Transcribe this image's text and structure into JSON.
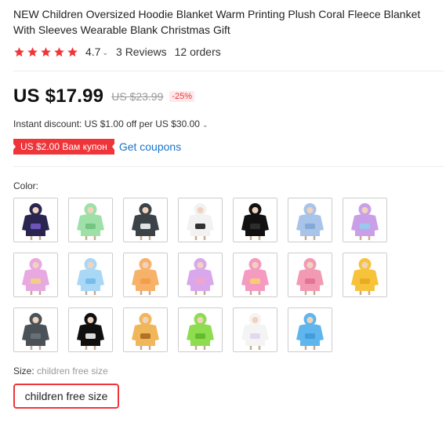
{
  "product": {
    "title": "NEW Children Oversized Hoodie Blanket Warm Printing Plush Coral Fleece Blanket With Sleeves Wearable Blank Christmas Gift",
    "rating": "4.7",
    "reviews": "3 Reviews",
    "orders": "12 orders",
    "star_color": "#f0353a",
    "star_count": 5
  },
  "pricing": {
    "price": "US $17.99",
    "old_price": "US $23.99",
    "discount": "-25%",
    "instant_discount": "Instant discount: US $1.00 off per US $30.00",
    "coupon_tag": "US $2.00 Вам купон",
    "get_coupons": "Get coupons",
    "accent_color": "#f0353a",
    "link_color": "#1a73c7"
  },
  "options": {
    "color_label": "Color:",
    "colors": [
      {
        "name": "black-galaxy",
        "body": "#2a2550",
        "accent": "#7a5ccf",
        "bg": "#ffffff"
      },
      {
        "name": "green-cactus",
        "body": "#9fe0a8",
        "accent": "#6cc07a",
        "bg": "#ffffff"
      },
      {
        "name": "dark-grey-face",
        "body": "#3b4248",
        "accent": "#ffffff",
        "bg": "#ffffff"
      },
      {
        "name": "cow-print",
        "body": "#f2f2f2",
        "accent": "#111111",
        "bg": "#ffffff"
      },
      {
        "name": "black-plain",
        "body": "#111111",
        "accent": "#333333",
        "bg": "#ffffff"
      },
      {
        "name": "light-blue-print",
        "body": "#a8c4e8",
        "accent": "#7fa3d6",
        "bg": "#ffffff"
      },
      {
        "name": "tie-dye-purple",
        "body": "#c9a0e8",
        "accent": "#8fd0f0",
        "bg": "#ffffff"
      },
      {
        "name": "tie-dye-rainbow",
        "body": "#e8a8e0",
        "accent": "#f3d27a",
        "bg": "#ffffff"
      },
      {
        "name": "sky-blue",
        "body": "#a8d8f5",
        "accent": "#6fb8e8",
        "bg": "#ffffff"
      },
      {
        "name": "peach-orange",
        "body": "#f7b26a",
        "accent": "#f39a45",
        "bg": "#ffffff"
      },
      {
        "name": "unicorn-lilac",
        "body": "#d9a8ec",
        "accent": "#f4a4c4",
        "bg": "#ffffff"
      },
      {
        "name": "rainbow-stripe",
        "body": "#f59ac0",
        "accent": "#f7d46a",
        "bg": "#ffffff"
      },
      {
        "name": "pink",
        "body": "#f29ab4",
        "accent": "#e06d93",
        "bg": "#ffffff"
      },
      {
        "name": "yellow-bear",
        "body": "#f6c33b",
        "accent": "#e5a81f",
        "bg": "#ffffff"
      },
      {
        "name": "dark-grey-dino",
        "body": "#4a5258",
        "accent": "#6d767c",
        "bg": "#ffffff"
      },
      {
        "name": "black-panda",
        "body": "#0f0f0f",
        "accent": "#ffffff",
        "bg": "#ffffff"
      },
      {
        "name": "giraffe",
        "body": "#f0b65a",
        "accent": "#a8641d",
        "bg": "#ffffff"
      },
      {
        "name": "green-frog",
        "body": "#8edc4f",
        "accent": "#5fb42a",
        "bg": "#ffffff"
      },
      {
        "name": "white-unicorn",
        "body": "#f4f4f4",
        "accent": "#e0d4ea",
        "bg": "#ffffff"
      },
      {
        "name": "light-blue-plain",
        "body": "#5fb6ec",
        "accent": "#3d9ad8",
        "bg": "#ffffff"
      }
    ],
    "size_label": "Size:",
    "size_value": "children free size",
    "size_option": "children free size"
  }
}
